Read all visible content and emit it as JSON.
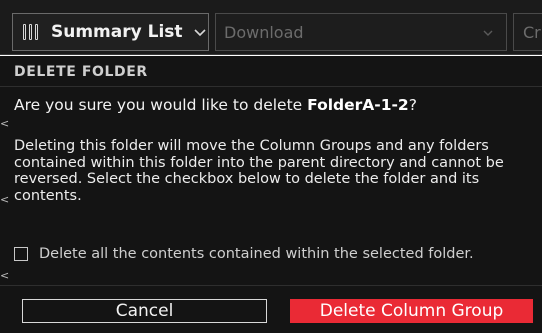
{
  "toolbar": {
    "view_select": {
      "label": "Summary List",
      "icon": "columns-icon"
    },
    "download_select": {
      "placeholder": "Download"
    },
    "clipped_select": {
      "text": "Cr"
    }
  },
  "dialog": {
    "title": "DELETE FOLDER",
    "question_prefix": "Are you sure you would like to delete ",
    "folder_name": "FolderA-1-2",
    "question_suffix": "?",
    "description": "Deleting this folder will move the Column Groups and any folders contained within this folder into the parent directory and cannot be reversed. Select the checkbox below to delete the folder and its contents.",
    "checkbox": {
      "label": "Delete all the contents contained within the selected folder.",
      "checked": false
    },
    "cancel_label": "Cancel",
    "confirm_label": "Delete Column Group",
    "confirm_color": "#ea2a35"
  }
}
